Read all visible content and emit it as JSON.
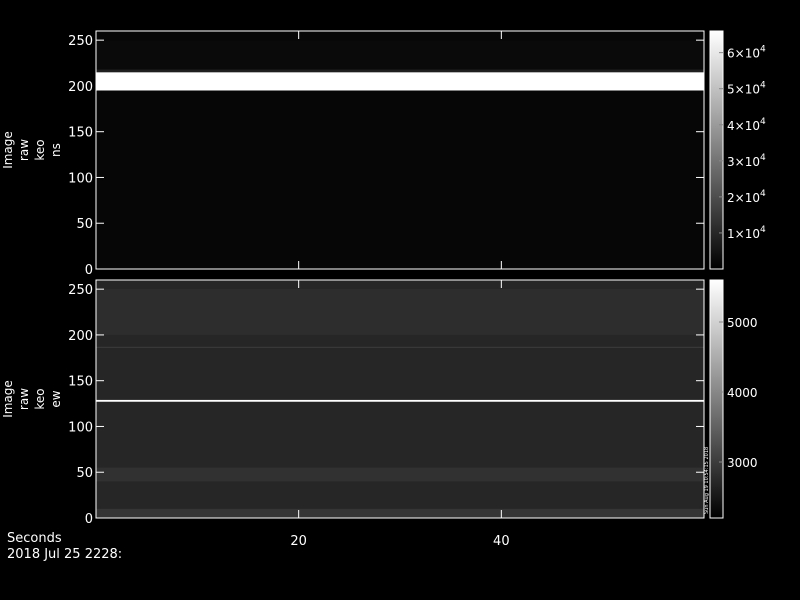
{
  "chart_data": [
    {
      "type": "heatmap",
      "ylabel": [
        "Image",
        "raw",
        "keo",
        "ns"
      ],
      "yticks": [
        0,
        50,
        100,
        150,
        200,
        250
      ],
      "ylim": [
        0,
        260
      ],
      "xlim": [
        0,
        60
      ],
      "xticks": [
        20,
        40
      ],
      "xtick_labels": [
        "",
        ""
      ],
      "colorbar": {
        "range": [
          0,
          66000
        ],
        "ticks": [
          10000,
          20000,
          30000,
          40000,
          50000,
          60000
        ],
        "labels": [
          {
            "mantissa": "1×10",
            "exp": "4"
          },
          {
            "mantissa": "2×10",
            "exp": "4"
          },
          {
            "mantissa": "3×10",
            "exp": "4"
          },
          {
            "mantissa": "4×10",
            "exp": "4"
          },
          {
            "mantissa": "5×10",
            "exp": "4"
          },
          {
            "mantissa": "6×10",
            "exp": "4"
          }
        ]
      },
      "background_value": 1500,
      "bands": [
        {
          "y": [
            195,
            215
          ],
          "value": 66000
        },
        {
          "y": [
            215,
            218
          ],
          "value": 8000
        },
        {
          "y": [
            218,
            250
          ],
          "value": 2500
        }
      ]
    },
    {
      "type": "heatmap",
      "ylabel": [
        "Image",
        "raw",
        "keo",
        "ew"
      ],
      "yticks": [
        0,
        50,
        100,
        150,
        200,
        250
      ],
      "ylim": [
        0,
        260
      ],
      "xlim": [
        0,
        60
      ],
      "xticks": [
        20,
        40
      ],
      "xtick_labels": [
        "20",
        "40"
      ],
      "colorbar": {
        "range": [
          2200,
          5600
        ],
        "ticks": [
          3000,
          4000,
          5000
        ],
        "labels": [
          {
            "mantissa": "3000",
            "exp": ""
          },
          {
            "mantissa": "4000",
            "exp": ""
          },
          {
            "mantissa": "5000",
            "exp": ""
          }
        ]
      },
      "background_value": 2700,
      "bands": [
        {
          "y": [
            0,
            10
          ],
          "value": 2900
        },
        {
          "y": [
            40,
            55
          ],
          "value": 2850
        },
        {
          "y": [
            127,
            129
          ],
          "value": 5600
        },
        {
          "y": [
            186,
            187
          ],
          "value": 3000
        },
        {
          "y": [
            200,
            250
          ],
          "value": 2800
        }
      ]
    }
  ],
  "footer": {
    "line1": "Seconds",
    "line2": "2018 Jul 25 2228:"
  },
  "stamp": "Sun Aug 19 10:54:15 2018"
}
